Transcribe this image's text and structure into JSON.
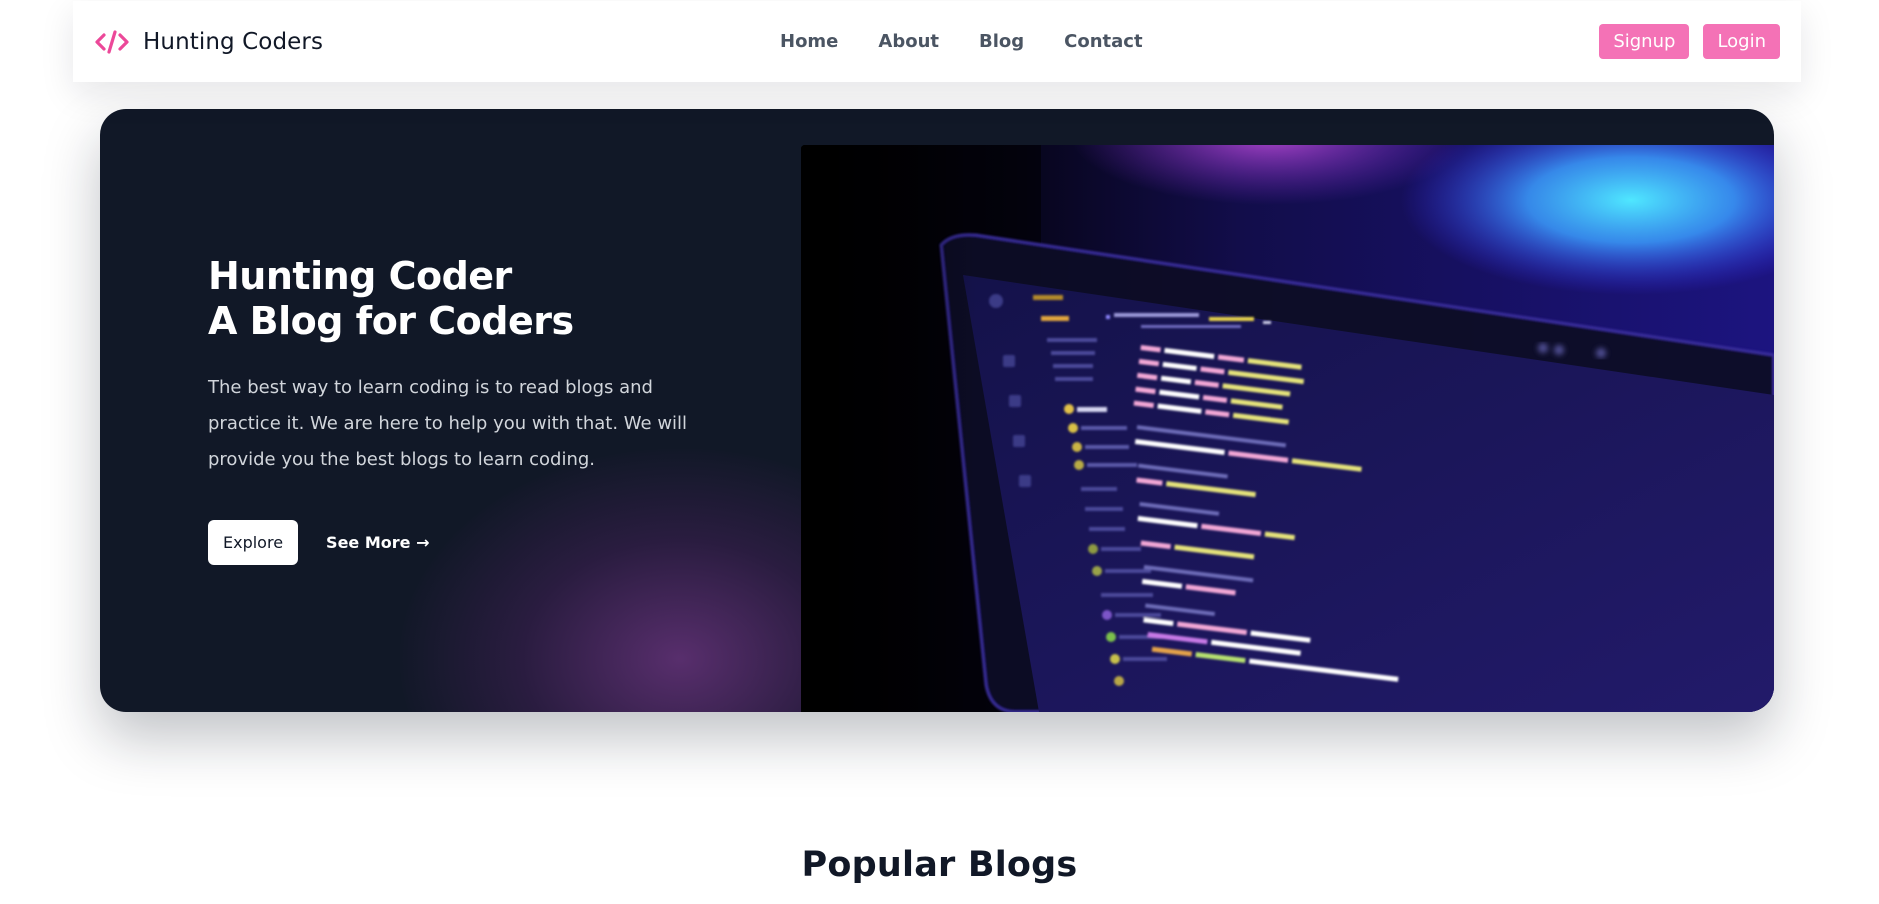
{
  "brand": {
    "name": "Hunting Coders",
    "icon": "code-brackets-icon",
    "accent_color": "#ec4899"
  },
  "nav": {
    "links": [
      "Home",
      "About",
      "Blog",
      "Contact"
    ],
    "signup_label": "Signup",
    "login_label": "Login",
    "button_color": "#f472b6"
  },
  "hero": {
    "title_line1": "Hunting Coder",
    "title_line2": "A Blog for Coders",
    "description": "The best way to learn coding is to read blogs and practice it. We are here to help you with that. We will provide you the best blogs to learn coding.",
    "explore_label": "Explore",
    "see_more_label": "See More →",
    "image": "laptop-code-editor-image",
    "background_color": "#111827"
  },
  "popular": {
    "title": "Popular Blogs"
  }
}
